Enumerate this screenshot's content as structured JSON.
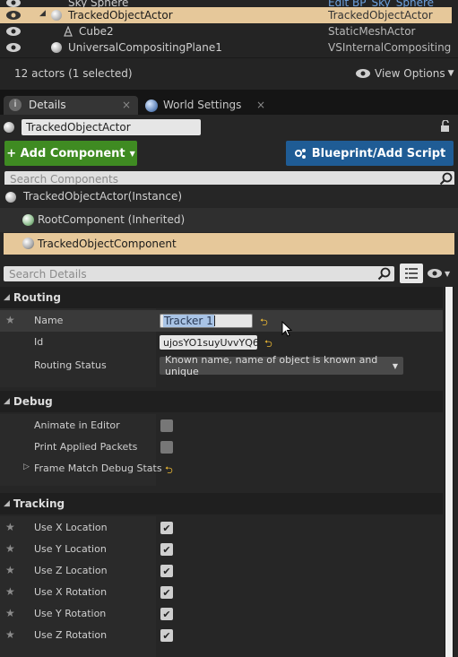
{
  "outliner": {
    "rows": [
      {
        "name": "Sky Sphere",
        "type": "Edit BP_Sky_Sphere"
      },
      {
        "name": "TrackedObjectActor",
        "type": "TrackedObjectActor"
      },
      {
        "name": "Cube2",
        "type": "StaticMeshActor"
      },
      {
        "name": "UniversalCompositingPlane1",
        "type": "VSInternalCompositingPl"
      }
    ],
    "actor_count": "12 actors (1 selected)",
    "view_options": "View Options"
  },
  "tabs": [
    {
      "label": "Details",
      "close": "×"
    },
    {
      "label": "World Settings",
      "close": "×"
    }
  ],
  "details": {
    "actor_name": "TrackedObjectActor",
    "add_component": "+ Add Component",
    "blueprint_script": "Blueprint/Add Script",
    "search_components_placeholder": "Search Components",
    "components": [
      {
        "label": "TrackedObjectActor(Instance)"
      },
      {
        "label": "RootComponent (Inherited)"
      },
      {
        "label": "TrackedObjectComponent"
      }
    ],
    "search_details_placeholder": "Search Details",
    "categories": {
      "routing": {
        "title": "Routing",
        "name_label": "Name",
        "name_value": "Tracker 1",
        "id_label": "Id",
        "id_value": "ujosYO1suyUvvYQ6",
        "status_label": "Routing Status",
        "status_value": "Known name, name of object is known and unique"
      },
      "debug": {
        "title": "Debug",
        "animate_label": "Animate in Editor",
        "animate_checked": false,
        "print_label": "Print Applied Packets",
        "print_checked": false,
        "frame_match_label": "Frame Match Debug Stats"
      },
      "tracking": {
        "title": "Tracking",
        "items": [
          {
            "label": "Use X Location",
            "checked": true
          },
          {
            "label": "Use Y Location",
            "checked": true
          },
          {
            "label": "Use Z Location",
            "checked": true
          },
          {
            "label": "Use X Rotation",
            "checked": true
          },
          {
            "label": "Use Y Rotation",
            "checked": true
          },
          {
            "label": "Use Z Rotation",
            "checked": true
          }
        ]
      }
    }
  },
  "colors": {
    "selection": "#e6c89a",
    "add_component_green": "#3f8b22",
    "blueprint_blue": "#1f5c95",
    "reset_arrow": "#e7b534"
  }
}
